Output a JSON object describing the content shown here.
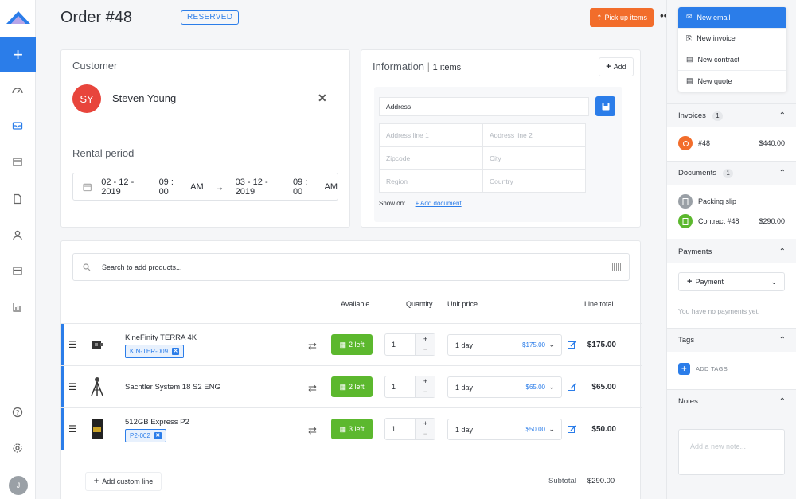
{
  "header": {
    "order_title": "Order #48",
    "status_badge": "RESERVED",
    "pickup_label": "Pick up items"
  },
  "customer": {
    "heading": "Customer",
    "initials": "SY",
    "name": "Steven Young",
    "rental_heading": "Rental period",
    "start_date": "02 - 12 - 2019",
    "start_time": "09 : 00",
    "start_ampm": "AM",
    "end_date": "03 - 12 - 2019",
    "end_time": "09 : 00",
    "end_ampm": "AM"
  },
  "information": {
    "heading": "Information",
    "count": "1 items",
    "add_label": "Add",
    "address_label": "Address",
    "fields": [
      "Address line 1",
      "Address line 2",
      "Zipcode",
      "City",
      "Region",
      "Country"
    ],
    "show_on_label": "Show on:",
    "add_document_label": "+ Add document"
  },
  "products": {
    "search_placeholder": "Search to add products...",
    "columns": {
      "available": "Available",
      "quantity": "Quantity",
      "unit_price": "Unit price",
      "line_total": "Line total"
    },
    "rows": [
      {
        "name": "KineFinity TERRA 4K",
        "sku": "KIN-TER-009",
        "available": "2 left",
        "qty": "1",
        "period": "1 day",
        "price": "$175.00",
        "total": "$175.00"
      },
      {
        "name": "Sachtler System 18 S2 ENG",
        "sku": "",
        "available": "2 left",
        "qty": "1",
        "period": "1 day",
        "price": "$65.00",
        "total": "$65.00"
      },
      {
        "name": "512GB Express P2",
        "sku": "P2-002",
        "available": "3 left",
        "qty": "1",
        "period": "1 day",
        "price": "$50.00",
        "total": "$50.00"
      }
    ],
    "add_custom_line": "Add custom line",
    "subtotal_label": "Subtotal",
    "subtotal_value": "$290.00"
  },
  "actions_menu": [
    "New email",
    "New invoice",
    "New contract",
    "New quote"
  ],
  "sidebar": {
    "invoices": {
      "title": "Invoices",
      "count": "1",
      "items": [
        {
          "label": "#48",
          "amount": "$440.00"
        }
      ]
    },
    "documents": {
      "title": "Documents",
      "count": "1",
      "items": [
        {
          "label": "Packing slip",
          "amount": ""
        },
        {
          "label": "Contract #48",
          "amount": "$290.00"
        }
      ]
    },
    "payments": {
      "title": "Payments",
      "button": "Payment",
      "empty": "You have no payments yet."
    },
    "tags": {
      "title": "Tags",
      "add_label": "ADD TAGS"
    },
    "notes": {
      "title": "Notes",
      "placeholder": "Add a new note..."
    }
  },
  "user_initial": "J",
  "colors": {
    "accent": "#2b7de9",
    "orange": "#f26d2b",
    "green": "#5cb82e",
    "red": "#e8453c"
  }
}
